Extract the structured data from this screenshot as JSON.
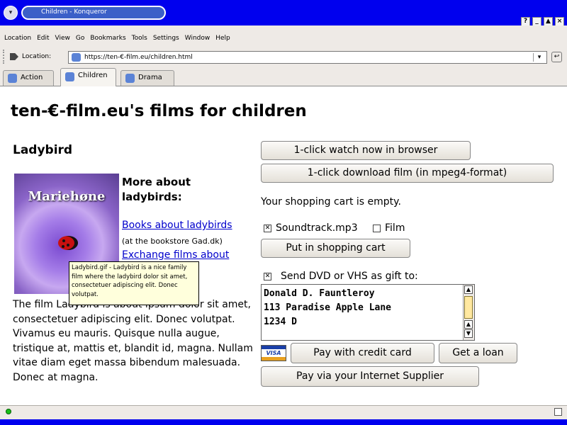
{
  "window": {
    "title": "Children - Konqueror",
    "buttons": [
      "?",
      "_",
      "▲",
      "×"
    ]
  },
  "menubar": {
    "items": [
      "Location",
      "Edit",
      "View",
      "Go",
      "Bookmarks",
      "Tools",
      "Settings",
      "Window",
      "Help"
    ]
  },
  "location": {
    "label": "Location:",
    "url": "https://ten-€-film.eu/children.html"
  },
  "tabs": [
    {
      "label": "Action",
      "active": false
    },
    {
      "label": "Children",
      "active": true
    },
    {
      "label": "Drama",
      "active": false
    }
  ],
  "page": {
    "title": "ten-€-film.eu's films for children",
    "film_title": "Ladybird",
    "poster_label": "Mariehøne",
    "more_heading": "More about ladybirds:",
    "link_books": "Books about ladybirds",
    "bookstore_note": "(at the bookstore Gad.dk)",
    "link_exchange": "Exchange films about",
    "tooltip": "Ladybird.gif - Ladybird is a nice family film where the ladybird dolor sit amet, consectetuer adipiscing elit. Donec volutpat.",
    "description": "The film Ladybird is about ipsum dolor sit amet, consectetuer adipiscing elit. Donec volutpat. Vivamus eu mauris. Quisque nulla augue, tristique at, mattis et, blandit id, magna. Nullam vitae diam eget massa bibendum malesuada. Donec at magna."
  },
  "actions": {
    "watch_label": "1-click watch now in browser",
    "download_label": "1-click download film (in mpeg4-format)",
    "cart_status": "Your shopping cart is empty.",
    "soundtrack_label": "Soundtrack.mp3",
    "soundtrack_checked": true,
    "film_label": "Film",
    "film_checked": false,
    "cart_button": "Put in shopping cart",
    "gift_label": "Send DVD or VHS as gift to:",
    "gift_checked": true,
    "gift_address": "Donald D. Fauntleroy\n113 Paradise Apple Lane\n1234 D",
    "visa_label": "VISA",
    "credit_button": "Pay with credit card",
    "loan_button": "Get a loan",
    "isp_button": "Pay via your Internet Supplier"
  }
}
